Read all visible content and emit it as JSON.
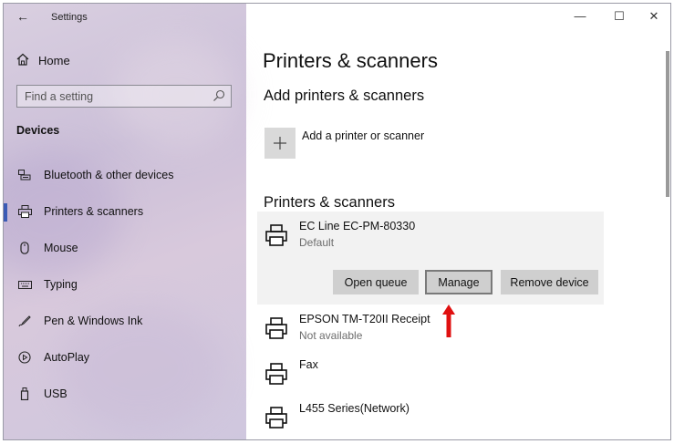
{
  "window": {
    "app_title": "Settings",
    "controls": {
      "minimize": "—",
      "maximize": "☐",
      "close": "✕"
    }
  },
  "sidebar": {
    "home_label": "Home",
    "search_placeholder": "Find a setting",
    "section_label": "Devices",
    "items": [
      {
        "label": "Bluetooth & other devices",
        "icon": "bluetooth-devices-icon"
      },
      {
        "label": "Printers & scanners",
        "icon": "printer-icon",
        "selected": true
      },
      {
        "label": "Mouse",
        "icon": "mouse-icon"
      },
      {
        "label": "Typing",
        "icon": "keyboard-icon"
      },
      {
        "label": "Pen & Windows Ink",
        "icon": "pen-icon"
      },
      {
        "label": "AutoPlay",
        "icon": "autoplay-icon"
      },
      {
        "label": "USB",
        "icon": "usb-icon"
      }
    ]
  },
  "main": {
    "page_title": "Printers & scanners",
    "add_heading": "Add printers & scanners",
    "add_label": "Add a printer or scanner",
    "list_heading": "Printers & scanners",
    "printers": [
      {
        "name": "EC Line EC-PM-80330",
        "status": "Default",
        "selected": true
      },
      {
        "name": "EPSON TM-T20II Receipt",
        "status": "Not available"
      },
      {
        "name": "Fax",
        "status": ""
      },
      {
        "name": "L455 Series(Network)",
        "status": ""
      }
    ],
    "buttons": {
      "open_queue": "Open queue",
      "manage": "Manage",
      "remove": "Remove device"
    }
  },
  "colors": {
    "accent": "#3b5bb5",
    "annotation_arrow": "#e01010"
  }
}
